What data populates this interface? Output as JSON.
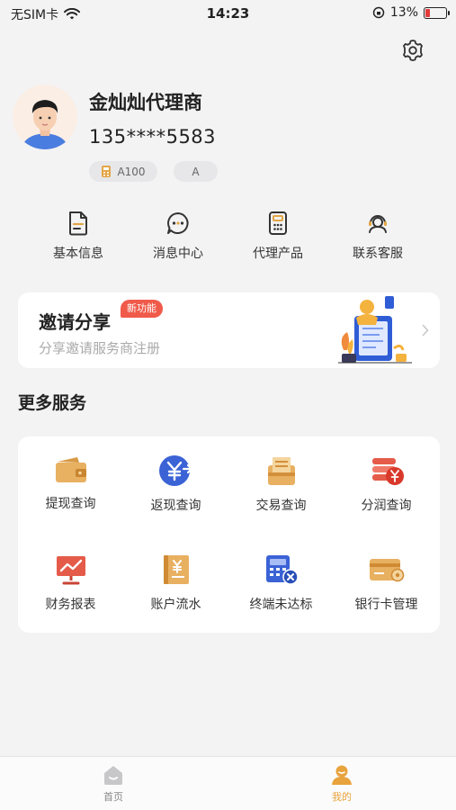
{
  "status_bar": {
    "carrier": "无SIM卡",
    "time": "14:23",
    "battery": "13%"
  },
  "profile": {
    "name": "金灿灿代理商",
    "phone": "135****5583",
    "tags": [
      "A100",
      "A"
    ]
  },
  "quick_menu": [
    {
      "label": "基本信息",
      "icon": "document-icon"
    },
    {
      "label": "消息中心",
      "icon": "message-icon"
    },
    {
      "label": "代理产品",
      "icon": "pos-terminal-icon"
    },
    {
      "label": "联系客服",
      "icon": "customer-service-icon"
    }
  ],
  "banner": {
    "title": "邀请分享",
    "badge": "新功能",
    "subtitle": "分享邀请服务商注册"
  },
  "more_services": {
    "title": "更多服务",
    "items": [
      {
        "label": "提现查询",
        "icon": "wallet-icon"
      },
      {
        "label": "返现查询",
        "icon": "yen-return-icon"
      },
      {
        "label": "交易查询",
        "icon": "receipt-box-icon"
      },
      {
        "label": "分润查询",
        "icon": "coin-stack-icon"
      },
      {
        "label": "财务报表",
        "icon": "chart-board-icon"
      },
      {
        "label": "账户流水",
        "icon": "ledger-icon"
      },
      {
        "label": "终端未达标",
        "icon": "calculator-x-icon"
      },
      {
        "label": "银行卡管理",
        "icon": "bank-card-icon"
      }
    ]
  },
  "bottom_nav": [
    {
      "label": "首页",
      "icon": "home-icon",
      "active": false
    },
    {
      "label": "我的",
      "icon": "profile-icon",
      "active": true
    }
  ],
  "colors": {
    "accent_orange": "#e8a33c",
    "badge_red": "#f05a4a",
    "background": "#f3f3f4"
  }
}
